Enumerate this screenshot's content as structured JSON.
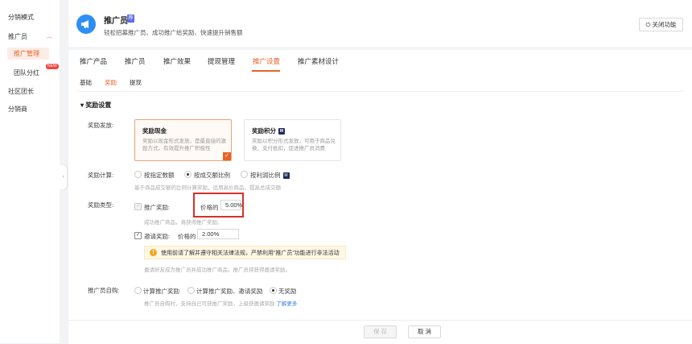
{
  "sidebar": {
    "items": [
      {
        "label": "分销模式"
      },
      {
        "label": "推广员"
      },
      {
        "label": "推广管理"
      },
      {
        "label": "团队分红",
        "badge": "NEW"
      },
      {
        "label": "社区团长"
      },
      {
        "label": "分销商"
      }
    ],
    "collapse_glyph": "‹"
  },
  "header": {
    "title": "推广员",
    "title_badge": "荐",
    "subtitle": "轻松招募推广员、成功推广给奖励、快速提升销售额",
    "close_label": "关闭功能"
  },
  "tabs": [
    {
      "label": "推广产品"
    },
    {
      "label": "推广员"
    },
    {
      "label": "推广效果"
    },
    {
      "label": "提现管理"
    },
    {
      "label": "推广设置",
      "active": true
    },
    {
      "label": "推广素材设计"
    }
  ],
  "subtabs": [
    {
      "label": "基础"
    },
    {
      "label": "奖励",
      "active": true
    },
    {
      "label": "提现"
    }
  ],
  "section": {
    "title": "奖励设置"
  },
  "reward_method": {
    "label": "奖励发放:",
    "cards": [
      {
        "title": "奖励现金",
        "desc": "奖励以现金形式发放，是最直接的激励方式，有效提升推广积极性",
        "selected": true
      },
      {
        "title": "奖励积分",
        "badge": "M",
        "desc": "奖励以积分形式发放，可用于商品兑换、支付抵扣，促进推广员消费",
        "selected": false
      }
    ]
  },
  "reward_calc": {
    "label": "奖励计算:",
    "options": [
      {
        "label": "按指定数额",
        "checked": false
      },
      {
        "label": "按成交额比例",
        "checked": true
      },
      {
        "label": "按利润比例",
        "badge": "M",
        "checked": false
      }
    ],
    "hint": "基于商品成交额的比例计算奖励，适用高价商品，提高总成交额"
  },
  "reward_type": {
    "label": "奖励类型:",
    "promo": {
      "label": "推广奖励:",
      "price_label": "价格的",
      "value": "5.00%",
      "hint": "成功推广商品，将获得推广奖励。"
    },
    "invite": {
      "label": "邀请奖励:",
      "price_label": "价格的",
      "value": "2.00%"
    },
    "warning": "使用前请了解并遵守相关法律法规，严禁利用“推广员”功能进行非法活动",
    "invite_hint": "邀请好友成为推广员并成功推广商品，推广员将获得邀请奖励。"
  },
  "self_purchase": {
    "label": "推广员自购:",
    "options": [
      {
        "label": "计算推广奖励",
        "checked": false
      },
      {
        "label": "计算推广奖励、邀请奖励",
        "checked": false
      },
      {
        "label": "无奖励",
        "checked": true
      }
    ],
    "hint": "推广员自购时，支持自己可获推广奖励，上级获邀请奖励",
    "link": "了解更多"
  },
  "footer": {
    "save_label": "保 存",
    "cancel_label": "取 消"
  },
  "colors": {
    "accent": "#e8632a",
    "link": "#2f7de1",
    "highlight": "#d93026"
  }
}
